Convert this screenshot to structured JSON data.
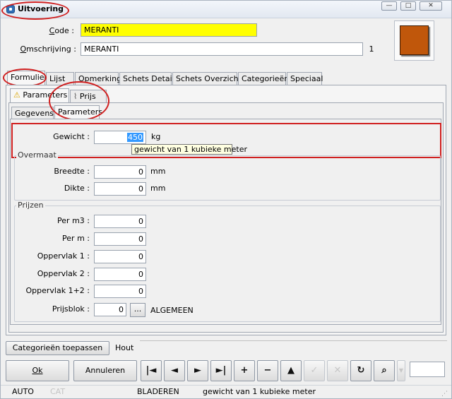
{
  "window": {
    "title": "Uitvoering",
    "minimize": "—",
    "maximize": "□",
    "close": "✕"
  },
  "header": {
    "code_label": "Code :",
    "code_value": "MERANTI",
    "omschrijving_label": "Omschrijving :",
    "omschrijving_value": "MERANTI",
    "counter": "1",
    "swatch_color": "#c0570b"
  },
  "tabs": [
    "Formulier",
    "Lijst",
    "Opmerking",
    "Schets Detail",
    "Schets Overzicht",
    "Categorieën",
    "Speciaal"
  ],
  "subtabs": [
    "Parameters",
    "Prijs"
  ],
  "subsubtabs": [
    "Gegevens",
    "Parameters"
  ],
  "gewicht": {
    "label": "Gewicht :",
    "value": "450",
    "unit": "kg",
    "tooltip": "gewicht van 1 kubieke meter"
  },
  "overmaat": {
    "title": "Overmaat",
    "breedte_label": "Breedte :",
    "breedte_value": "0",
    "breedte_unit": "mm",
    "dikte_label": "Dikte :",
    "dikte_value": "0",
    "dikte_unit": "mm"
  },
  "prijzen": {
    "title": "Prijzen",
    "rows": [
      {
        "label": "Per m3 :",
        "value": "0"
      },
      {
        "label": "Per m :",
        "value": "0"
      },
      {
        "label": "Oppervlak 1 :",
        "value": "0"
      },
      {
        "label": "Oppervlak 2 :",
        "value": "0"
      },
      {
        "label": "Oppervlak 1+2 :",
        "value": "0"
      }
    ],
    "prijsblok_label": "Prijsblok :",
    "prijsblok_value": "0",
    "prijsblok_button": "...",
    "prijsblok_name": "ALGEMEEN"
  },
  "bottom": {
    "categorieen_button": "Categorieën toepassen",
    "hout_label": "Hout",
    "ok_button": "Ok",
    "annuleren_button": "Annuleren"
  },
  "nav": {
    "first": "|◄",
    "prev": "◄",
    "next": "►",
    "last": "►|",
    "add": "+",
    "remove": "−",
    "up": "▲",
    "confirm": "✓",
    "cancel": "✕",
    "refresh": "↻",
    "find": "⌕"
  },
  "statusbar": {
    "mode": "AUTO",
    "cat": "CAT",
    "state": "BLADEREN",
    "hint": "gewicht van 1 kubieke meter"
  }
}
